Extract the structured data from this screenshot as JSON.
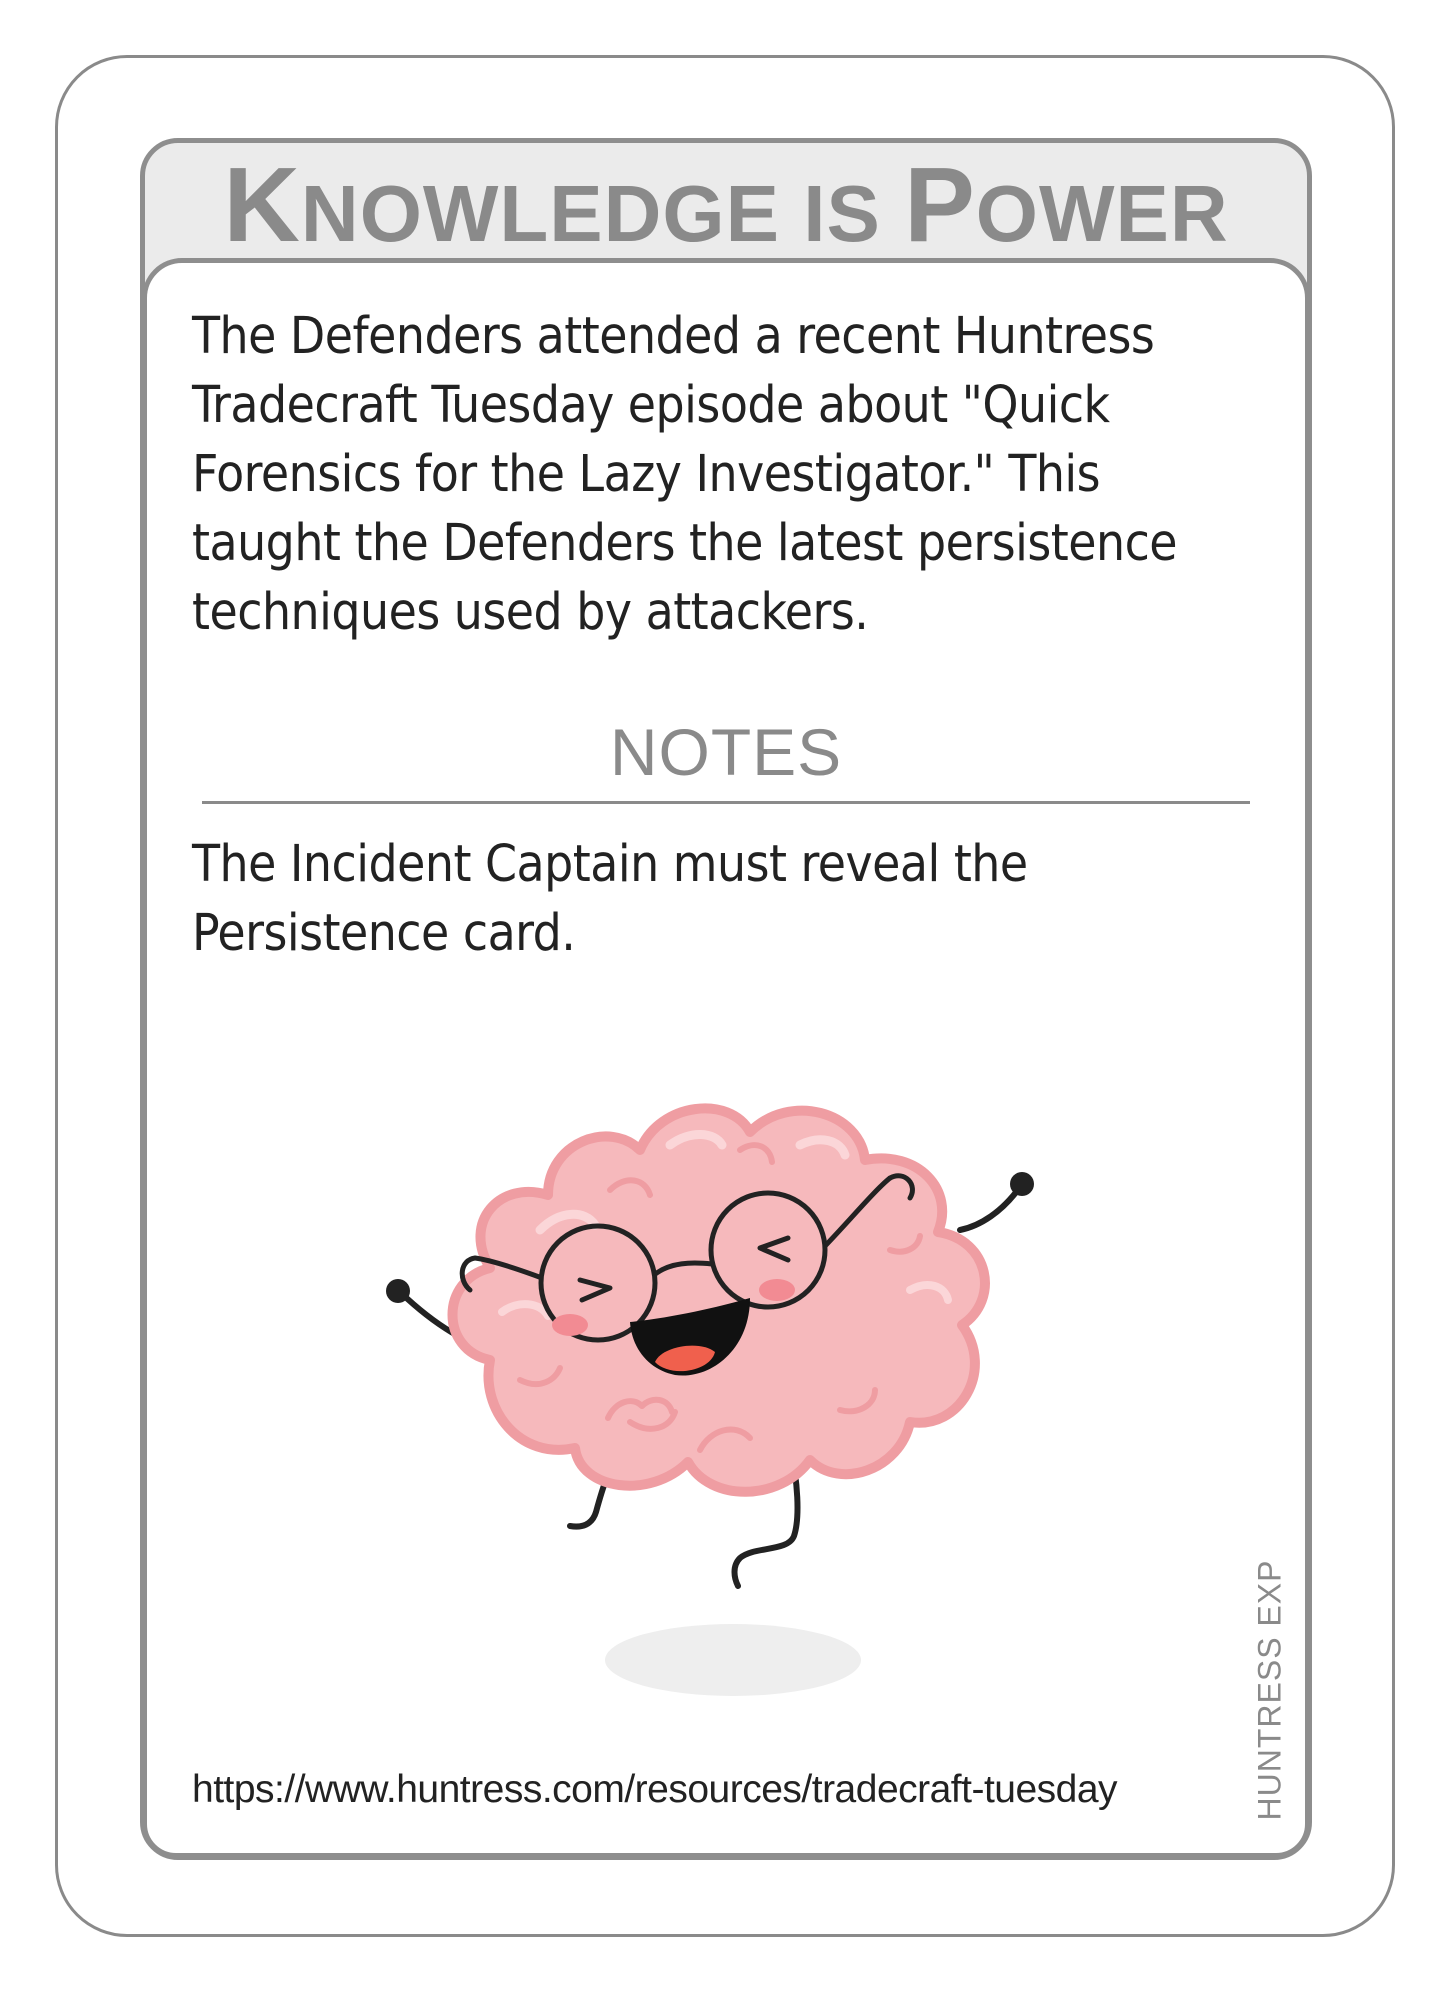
{
  "card": {
    "title_parts": [
      {
        "text": "K",
        "size": "cap"
      },
      {
        "text": "NOWLEDGE ",
        "size": "sm"
      },
      {
        "text": "IS ",
        "size": "sm"
      },
      {
        "text": "P",
        "size": "cap"
      },
      {
        "text": "OWER",
        "size": "sm"
      }
    ],
    "title": "Knowledge is Power",
    "description": "The Defenders attended a recent Huntress Tradecraft Tuesday episode about \"Quick Forensics for the Lazy Investigator.\" This taught the Defenders the latest persistence techniques used by attackers.",
    "notes_heading": "NOTES",
    "notes_text": "The Incident Captain must reveal the Persistence card.",
    "url": "https://www.huntress.com/resources/tradecraft-tuesday",
    "side_tag": "HUNTRESS EXP",
    "illustration": "happy-brain-with-glasses"
  },
  "colors": {
    "frame_gray": "#8e8e8e",
    "title_gray": "#8a8a8a",
    "brain_pink": "#f6b9bc",
    "brain_outline": "#ef9da2",
    "cheek": "#f28b93",
    "mouth": "#111111",
    "tongue": "#f0604d"
  }
}
